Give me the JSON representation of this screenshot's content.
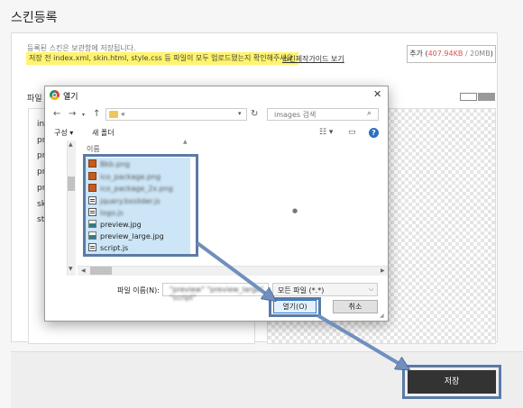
{
  "page": {
    "title": "스킨등록"
  },
  "intro": {
    "text": "등록된 스킨은 보관함에 저장됩니다.",
    "notice": "저장 전 index.xml, skin.html, style.css 등 파일이 모두 업로드됐는지 확인해주세요.",
    "guide_link": "스킨제작가이드 보기"
  },
  "add_button": {
    "label": "추가",
    "used": "407.94KB",
    "separator": " / ",
    "limit": "20MB"
  },
  "files_section": {
    "label": "파일",
    "rows": [
      "in",
      "pr",
      "pr",
      "pr",
      "pr",
      "sk",
      "st"
    ]
  },
  "save_button": {
    "label": "저장"
  },
  "dialog": {
    "title": "열기",
    "address": "«",
    "search_placeholder": "images 검색",
    "toolbar": {
      "organize": "구성 ▾",
      "new_folder": "새 폴더"
    },
    "column_header": "이름",
    "files": [
      {
        "name": "Bkb.png",
        "icon": "image-file",
        "blurred": true
      },
      {
        "name": "ico_package.png",
        "icon": "image-file",
        "blurred": true
      },
      {
        "name": "ico_package_2x.png",
        "icon": "image-file",
        "blurred": true
      },
      {
        "name": "jquery.bxslider.js",
        "icon": "script-file",
        "blurred": true
      },
      {
        "name": "logo.js",
        "icon": "script-file",
        "blurred": true
      },
      {
        "name": "preview.jpg",
        "icon": "image-file",
        "blurred": false
      },
      {
        "name": "preview_large.jpg",
        "icon": "image-file",
        "blurred": false
      },
      {
        "name": "script.js",
        "icon": "script-file",
        "blurred": false
      }
    ],
    "filename_label": "파일 이름(N):",
    "filename_value": "\"preview\" \"preview_large\" \"script\"",
    "filetype": "모든 파일 (*.*)",
    "open_button": "열기(O)",
    "cancel_button": "취소"
  },
  "colors": {
    "highlight_box": "#5b7aa5",
    "selection": "#cce6f7",
    "notice_bg": "#fff46c",
    "used_size": "#d9534f"
  }
}
